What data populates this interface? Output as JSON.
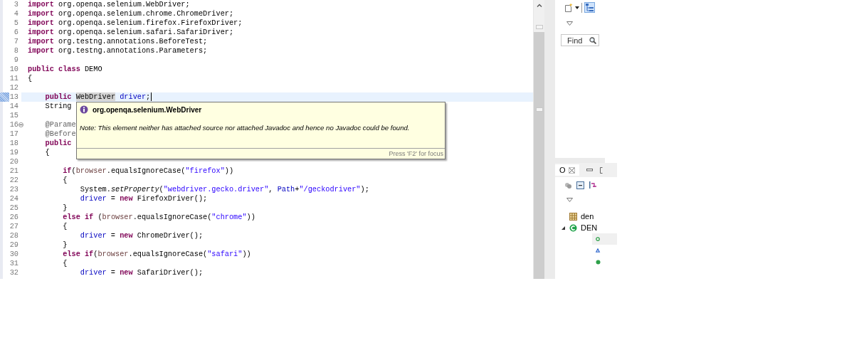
{
  "editor": {
    "lines": [
      {
        "number": "3",
        "current": false,
        "bookmark": false,
        "fold": false,
        "tokens": [
          {
            "text": "import",
            "kind": "keyword"
          },
          {
            "text": " org.openqa.selenium.WebDriver;",
            "kind": "plain"
          }
        ]
      },
      {
        "number": "4",
        "current": false,
        "bookmark": false,
        "fold": false,
        "tokens": [
          {
            "text": "import",
            "kind": "keyword"
          },
          {
            "text": " org.openqa.selenium.chrome.ChromeDriver;",
            "kind": "plain"
          }
        ]
      },
      {
        "number": "5",
        "current": false,
        "bookmark": false,
        "fold": false,
        "tokens": [
          {
            "text": "import",
            "kind": "keyword"
          },
          {
            "text": " org.openqa.selenium.firefox.FirefoxDriver;",
            "kind": "plain"
          }
        ]
      },
      {
        "number": "6",
        "current": false,
        "bookmark": false,
        "fold": false,
        "tokens": [
          {
            "text": "import",
            "kind": "keyword"
          },
          {
            "text": " org.openqa.selenium.safari.SafariDriver;",
            "kind": "plain"
          }
        ]
      },
      {
        "number": "7",
        "current": false,
        "bookmark": false,
        "fold": false,
        "tokens": [
          {
            "text": "import",
            "kind": "keyword"
          },
          {
            "text": " org.testng.annotations.BeforeTest;",
            "kind": "plain"
          }
        ]
      },
      {
        "number": "8",
        "current": false,
        "bookmark": false,
        "fold": false,
        "tokens": [
          {
            "text": "import",
            "kind": "keyword"
          },
          {
            "text": " org.testng.annotations.Parameters;",
            "kind": "plain"
          }
        ]
      },
      {
        "number": "9",
        "current": false,
        "bookmark": false,
        "fold": false
      },
      {
        "number": "10",
        "current": false,
        "bookmark": false,
        "fold": false,
        "tokens": [
          {
            "text": "public class",
            "kind": "keyword"
          },
          {
            "text": " DEMO",
            "kind": "plain"
          }
        ]
      },
      {
        "number": "11",
        "current": false,
        "bookmark": false,
        "fold": false,
        "tokens": [
          {
            "text": "{",
            "kind": "plain"
          }
        ]
      },
      {
        "number": "12",
        "current": false,
        "bookmark": false,
        "fold": false
      },
      {
        "number": "13",
        "current": true,
        "bookmark": true,
        "fold": false,
        "tokens": [
          {
            "text": "    public ",
            "kind": "keyword"
          },
          {
            "text": "WebDriver",
            "kind": "occurrence"
          },
          {
            "text": " driver",
            "kind": "field"
          },
          {
            "text": ";",
            "kind": "plain"
          }
        ]
      },
      {
        "number": "14",
        "current": false,
        "bookmark": false,
        "fold": false,
        "tokens": [
          {
            "text": "    String",
            "kind": "plain"
          }
        ]
      },
      {
        "number": "15",
        "current": false,
        "bookmark": false,
        "fold": false
      },
      {
        "number": "16",
        "current": false,
        "bookmark": false,
        "fold": true,
        "tokens": [
          {
            "text": "    @Parame",
            "kind": "annotation"
          }
        ]
      },
      {
        "number": "17",
        "current": false,
        "bookmark": false,
        "fold": false,
        "tokens": [
          {
            "text": "    @Before",
            "kind": "annotation"
          }
        ]
      },
      {
        "number": "18",
        "current": false,
        "bookmark": false,
        "fold": false,
        "tokens": [
          {
            "text": "    public",
            "kind": "keyword"
          }
        ]
      },
      {
        "number": "19",
        "current": false,
        "bookmark": false,
        "fold": false,
        "tokens": [
          {
            "text": "    {",
            "kind": "plain"
          }
        ]
      },
      {
        "number": "20",
        "current": false,
        "bookmark": false,
        "fold": false
      },
      {
        "number": "21",
        "current": false,
        "bookmark": false,
        "fold": false,
        "tokens": [
          {
            "text": "        if",
            "kind": "keyword"
          },
          {
            "text": "(",
            "kind": "plain"
          },
          {
            "text": "browser",
            "kind": "param"
          },
          {
            "text": ".equalsIgnoreCase(",
            "kind": "plain"
          },
          {
            "text": "\"firefox\"",
            "kind": "string"
          },
          {
            "text": "))",
            "kind": "plain"
          }
        ]
      },
      {
        "number": "22",
        "current": false,
        "bookmark": false,
        "fold": false,
        "tokens": [
          {
            "text": "        {",
            "kind": "plain"
          }
        ]
      },
      {
        "number": "23",
        "current": false,
        "bookmark": false,
        "fold": false,
        "tokens": [
          {
            "text": "            System.",
            "kind": "plain"
          },
          {
            "text": "setProperty",
            "kind": "static"
          },
          {
            "text": "(",
            "kind": "plain"
          },
          {
            "text": "\"webdriver.gecko.driver\"",
            "kind": "string"
          },
          {
            "text": ", ",
            "kind": "plain"
          },
          {
            "text": "Path",
            "kind": "field"
          },
          {
            "text": "+",
            "kind": "plain"
          },
          {
            "text": "\"/geckodriver\"",
            "kind": "string"
          },
          {
            "text": ");",
            "kind": "plain"
          }
        ]
      },
      {
        "number": "24",
        "current": false,
        "bookmark": false,
        "fold": false,
        "tokens": [
          {
            "text": "            driver",
            "kind": "field"
          },
          {
            "text": " = ",
            "kind": "plain"
          },
          {
            "text": "new",
            "kind": "keyword"
          },
          {
            "text": " FirefoxDriver();",
            "kind": "plain"
          }
        ]
      },
      {
        "number": "25",
        "current": false,
        "bookmark": false,
        "fold": false,
        "tokens": [
          {
            "text": "        }",
            "kind": "plain"
          }
        ]
      },
      {
        "number": "26",
        "current": false,
        "bookmark": false,
        "fold": false,
        "tokens": [
          {
            "text": "        else if",
            "kind": "keyword"
          },
          {
            "text": " (",
            "kind": "plain"
          },
          {
            "text": "browser",
            "kind": "param"
          },
          {
            "text": ".equalsIgnoreCase(",
            "kind": "plain"
          },
          {
            "text": "\"chrome\"",
            "kind": "string"
          },
          {
            "text": "))",
            "kind": "plain"
          }
        ]
      },
      {
        "number": "27",
        "current": false,
        "bookmark": false,
        "fold": false,
        "tokens": [
          {
            "text": "        {",
            "kind": "plain"
          }
        ]
      },
      {
        "number": "28",
        "current": false,
        "bookmark": false,
        "fold": false,
        "tokens": [
          {
            "text": "            driver",
            "kind": "field"
          },
          {
            "text": " = ",
            "kind": "plain"
          },
          {
            "text": "new",
            "kind": "keyword"
          },
          {
            "text": " ChromeDriver();",
            "kind": "plain"
          }
        ]
      },
      {
        "number": "29",
        "current": false,
        "bookmark": false,
        "fold": false,
        "tokens": [
          {
            "text": "        }",
            "kind": "plain"
          }
        ]
      },
      {
        "number": "30",
        "current": false,
        "bookmark": false,
        "fold": false,
        "tokens": [
          {
            "text": "        else if",
            "kind": "keyword"
          },
          {
            "text": "(",
            "kind": "plain"
          },
          {
            "text": "browser",
            "kind": "param"
          },
          {
            "text": ".equalsIgnoreCase(",
            "kind": "plain"
          },
          {
            "text": "\"safari\"",
            "kind": "string"
          },
          {
            "text": "))",
            "kind": "plain"
          }
        ]
      },
      {
        "number": "31",
        "current": false,
        "bookmark": false,
        "fold": false,
        "tokens": [
          {
            "text": "        {",
            "kind": "plain"
          }
        ]
      },
      {
        "number": "32",
        "current": false,
        "bookmark": false,
        "fold": false,
        "tokens": [
          {
            "text": "            driver",
            "kind": "field"
          },
          {
            "text": " = ",
            "kind": "plain"
          },
          {
            "text": "new",
            "kind": "keyword"
          },
          {
            "text": " SafariDriver();",
            "kind": "plain"
          }
        ]
      }
    ]
  },
  "tooltip": {
    "title": "org.openqa.selenium.WebDriver",
    "note": "Note: This element neither has attached source nor attached Javadoc and hence no Javadoc could be found.",
    "footer": "Press 'F2' for focus"
  },
  "side": {
    "find": {
      "placeholder": "Find"
    },
    "outline": {
      "tab": {
        "label": "O",
        "selected": true
      },
      "items": [
        {
          "label": "den",
          "kind": "package",
          "selected": false,
          "expanded": false
        },
        {
          "label": "DEN",
          "kind": "class",
          "selected": false,
          "expanded": true,
          "children": [
            {
              "kind": "field",
              "selected": true
            },
            {
              "kind": "constructor",
              "selected": false
            },
            {
              "kind": "method",
              "selected": false
            }
          ]
        }
      ]
    }
  }
}
